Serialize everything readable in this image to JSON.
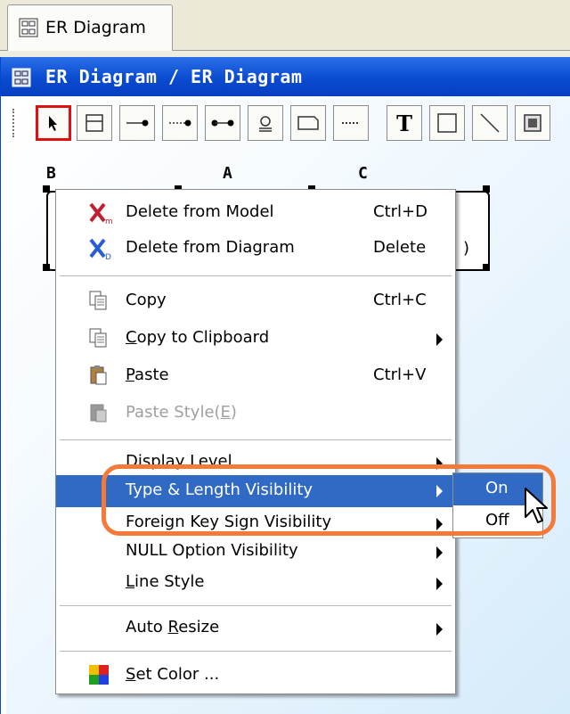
{
  "tab": {
    "label": "ER Diagram"
  },
  "window": {
    "title": "ER Diagram / ER Diagram"
  },
  "toolbar": {
    "buttons": [
      "select-tool",
      "entity-tool",
      "relationship-tool",
      "dashed-relationship-tool",
      "many-to-many-tool",
      "subtype-tool",
      "table-tool",
      "dashed-line-tool",
      "text-tool",
      "rectangle-tool",
      "line-tool",
      "image-tool"
    ]
  },
  "entity": {
    "columns": [
      "B",
      "A",
      "C"
    ],
    "overflow_text": ")"
  },
  "context_menu": {
    "delete_model": {
      "label": "Delete from Model",
      "shortcut": "Ctrl+D"
    },
    "delete_diagram": {
      "label": "Delete from Diagram",
      "shortcut": "Delete"
    },
    "copy": {
      "label": "Copy",
      "shortcut": "Ctrl+C"
    },
    "copy_clipboard": {
      "label_u": "C",
      "label_rest": "opy to Clipboard"
    },
    "paste": {
      "label_u": "P",
      "label_rest": "aste",
      "shortcut": "Ctrl+V"
    },
    "paste_style": {
      "label_pre": "Paste Style(",
      "label_u": "E",
      "label_post": ")"
    },
    "display_level": {
      "label": "Display Level"
    },
    "type_length": {
      "label": "Type & Length Visibility"
    },
    "foreign_key": {
      "label": "Foreign Key Sign Visibility"
    },
    "null_option": {
      "label": "NULL Option Visibility"
    },
    "line_style": {
      "label_u": "L",
      "label_rest": "ine Style"
    },
    "auto_resize": {
      "label_pre": "Auto ",
      "label_u": "R",
      "label_rest": "esize"
    },
    "set_color": {
      "label_u": "S",
      "label_rest": "et Color ..."
    }
  },
  "submenu": {
    "on": "On",
    "off": "Off"
  },
  "colors": {
    "highlight": "#316ac5",
    "callout": "#f47a3a",
    "titlebar": "#0a4bd0"
  }
}
